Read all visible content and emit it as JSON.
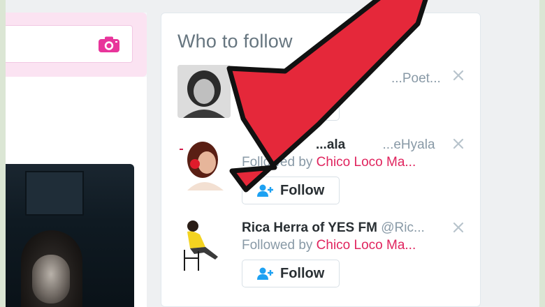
{
  "who_to_follow": {
    "title": "Who to follow",
    "suggestions": [
      {
        "name": "",
        "handle": "...Poet...",
        "followed_by_prefix": "",
        "followed_by_name": "",
        "follow_label": ""
      },
      {
        "name": "...ala",
        "handle": "...eHyala",
        "followed_by_prefix": "Followed by",
        "followed_by_name": "Chico Loco Ma...",
        "follow_label": "Follow"
      },
      {
        "name": "Rica Herra of YES FM",
        "handle": "@Ric...",
        "followed_by_prefix": "Followed by",
        "followed_by_name": "Chico Loco Ma...",
        "follow_label": "Follow"
      }
    ]
  },
  "colors": {
    "accent_pink": "#e0245e",
    "follow_icon_blue": "#1da1f2",
    "arrow_red": "#e5283a"
  },
  "icons": [
    "camera-icon",
    "add-person-icon",
    "close-icon",
    "pointer-arrow"
  ]
}
